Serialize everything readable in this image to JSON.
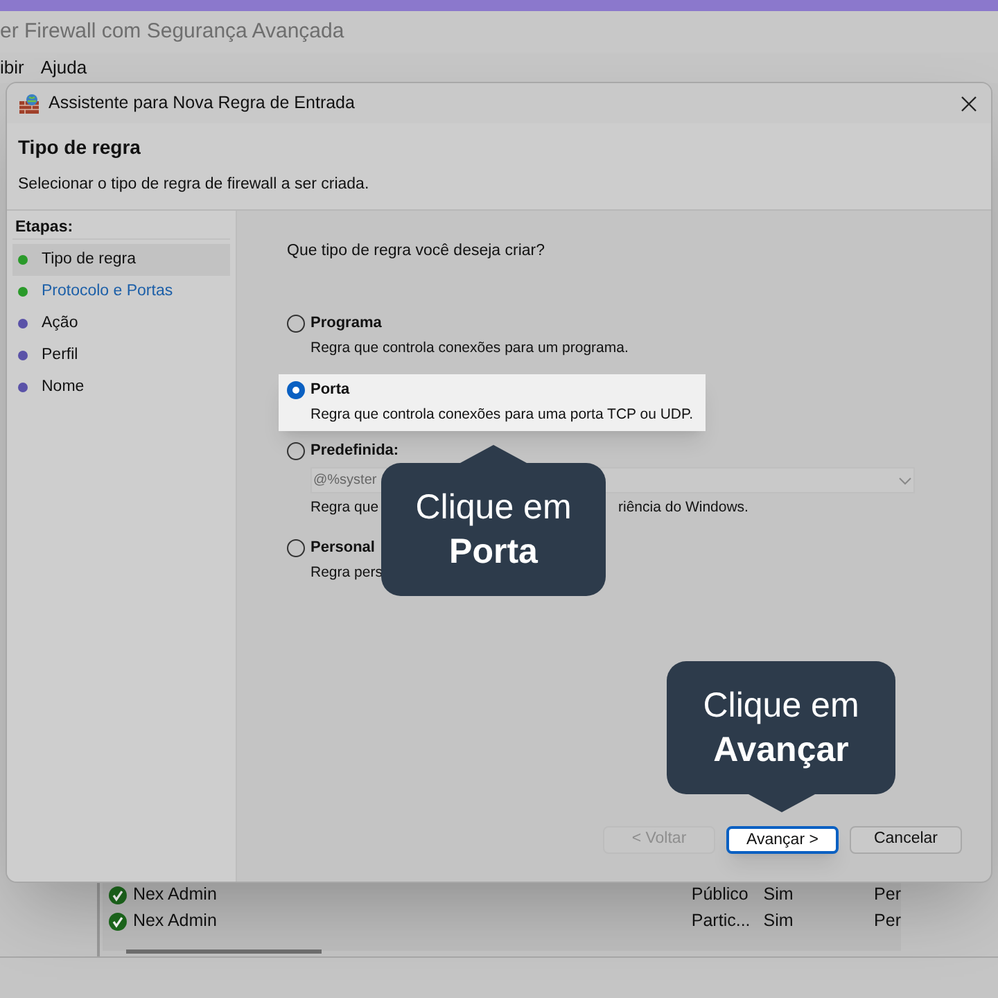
{
  "app_window": {
    "title": "er Firewall com Segurança Avançada",
    "menu": [
      "ibir",
      "Ajuda"
    ],
    "rows": [
      {
        "name": "Nex Admin",
        "profile": "Público",
        "enabled": "Sim",
        "column_4": "Per"
      },
      {
        "name": "Nex Admin",
        "profile": "Partic...",
        "enabled": "Sim",
        "column_4": "Per"
      }
    ]
  },
  "dialog": {
    "title": "Assistente para Nova Regra de Entrada",
    "heading": "Tipo de regra",
    "subtitle": "Selecionar o tipo de regra de firewall a ser criada.",
    "steps_label": "Etapas:",
    "steps": [
      {
        "label": "Tipo de regra",
        "selected": true,
        "done": true,
        "link": false
      },
      {
        "label": "Protocolo e Portas",
        "selected": false,
        "done": true,
        "link": true
      },
      {
        "label": "Ação",
        "selected": false,
        "done": false,
        "link": false
      },
      {
        "label": "Perfil",
        "selected": false,
        "done": false,
        "link": false
      },
      {
        "label": "Nome",
        "selected": false,
        "done": false,
        "link": false
      }
    ],
    "question": "Que tipo de regra você deseja criar?",
    "options": [
      {
        "label": "Programa",
        "description": [
          "Regra que controla conexões para um programa."
        ],
        "selected": false
      },
      {
        "label": "Porta",
        "description": [
          "Regra que controla conexões para uma porta TCP ou UDP."
        ],
        "selected": true
      },
      {
        "label": "Predefinida:",
        "dropdown": "@%syster",
        "description": [
          "Regra que",
          "riência do Windows."
        ],
        "selected": false
      },
      {
        "label": "Personal",
        "description": [
          "Regra pers"
        ],
        "selected": false
      }
    ],
    "buttons": [
      {
        "label": "< Voltar",
        "disabled": true,
        "default": false
      },
      {
        "label": "Avançar >",
        "disabled": false,
        "default": true
      },
      {
        "label": "Cancelar",
        "disabled": false,
        "default": false
      }
    ]
  },
  "callouts": [
    {
      "lines": [
        "Clique em",
        "Porta"
      ],
      "kind": "up"
    },
    {
      "lines": [
        "Clique em",
        "Avançar"
      ],
      "kind": "down"
    }
  ]
}
